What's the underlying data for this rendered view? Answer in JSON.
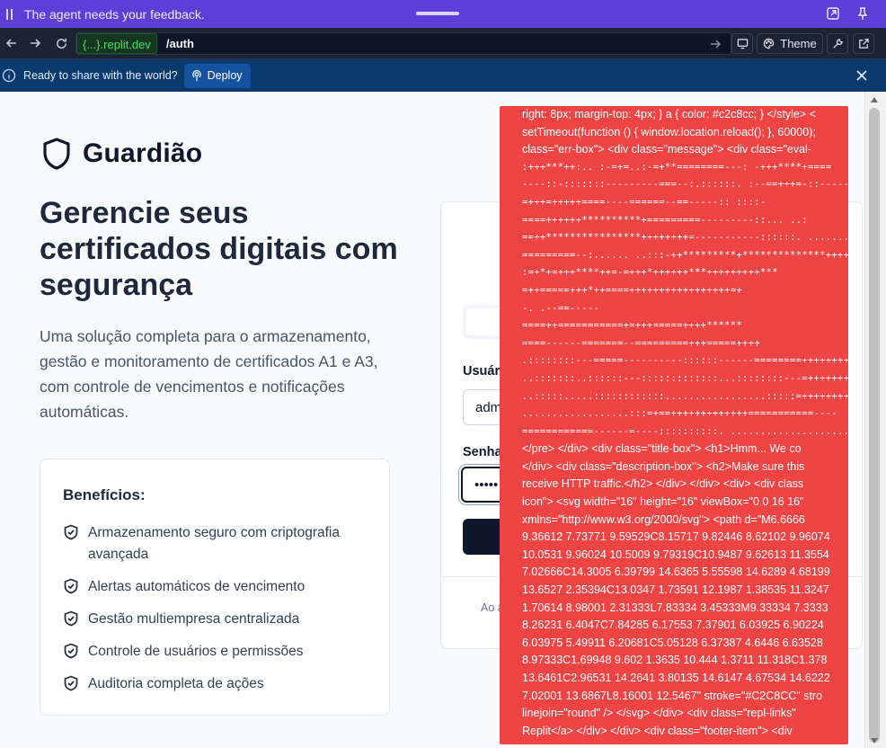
{
  "feedback": {
    "message": "The agent needs your feedback."
  },
  "browser": {
    "domain": "{...}.replit.dev",
    "path": "/auth",
    "theme_label": "Theme"
  },
  "deploy": {
    "ready_text": "Ready to share with the world?",
    "button_label": "Deploy"
  },
  "page": {
    "brand": "Guardião",
    "hero_title": "Gerencie seus certificados digitais com segurança",
    "hero_description": "Uma solução completa para o armazenamento, gestão e monitoramento de certificados A1 e A3, com controle de vencimentos e notificações automáticas.",
    "benefits_title": "Benefícios:",
    "benefits": [
      "Armazenamento seguro com criptografia avançada",
      "Alertas automáticos de vencimento",
      "Gestão multiempresa centralizada",
      "Controle de usuários e permissões",
      "Auditoria completa de ações"
    ]
  },
  "login": {
    "username_label": "Usuári",
    "username_value": "adm",
    "password_label": "Senha",
    "password_value": "•••••",
    "footer_text": "Ao a"
  },
  "error_overlay": {
    "lines": [
      "right: 8px; margin-top: 4px; } a { color: #c2c8cc; } </style> <",
      "setTimeout(function () { window.location.reload(); }, 60000);",
      "class=\"err-box\"> <div class=\"message\"> <div class=\"eval-",
      ":+++***++:.. :-=+=..:-=+**========---: -+++****+====",
      "----::-:::::::---------===--:.::::::. :--==+++=-::--------=======",
      "=+++=+++++====----======--==-----:: ::::-",
      "====++++++**********+=========---------::... ..:",
      "==++****************++++++++=-----------::::::. .......::::-=",
      "=========--:...... ..:::-++*********+**************++++++",
      ":=+*+=+++****++=-=+++*++++++***+++++++++***",
      "=++=====+++*++====+++++++++++++++++=+",
      "-. .--==-----",
      "====++===========+=+++=====++++******",
      "====------=======--=========+++=====++++",
      ".::::::::---=====----------::::::------========++++++++",
      "..:::::::..::::::---:::::::::::::...::::::::---=++++++++++****+++++++",
      "..:::::.....::::::::::::.................:::::=++++++++++*****++++++=====",
      "..................:::=+==+++++++++++++===========----",
      "============------=----::::::::::. ........................::::::::--",
      "</pre> </div> <div class=\"title-box\"> <h1>Hmm... We co",
      "</div> <div class=\"description-box\"> <h2>Make sure this",
      "receive HTTP traffic.</h2> </div> </div> <div> <div class",
      "icon\"> <svg width=\"16\" height=\"16\" viewBox=\"0 0 16 16\"",
      "xmlns=\"http://www.w3.org/2000/svg\"> <path d=\"M6.6666",
      "9.36612 7.73771 9.59529C8.15717 9.82446 8.62102 9.96074",
      "10.0531 9.96024 10.5009 9.79319C10.9487 9.62613 11.3554",
      "7.02666C14.3005 6.39799 14.6365 5.55598 14.6289 4.68199",
      "13.6527 2.35394C13.0347 1.73591 12.1987 1.38535 11.3247",
      "1.70614 8.98001 2.31333L7.83334 3.45333M9.33334 7.3333",
      "8.26231 6.4047C7.84285 6.17553 7.37901 6.03925 6.90224",
      "6.03975 5.49911 6.20681C5.05128 6.37387 4.6446 6.63528",
      "8.97333C1.69948 9.602 1.3635 10.444 1.3711 11.318C1.378",
      "13.6461C2.96531 14.2641 3.80135 14.6147 4.67534 14.6222",
      "7.02001 13.6867L8.16001 12.5467\" stroke=\"#C2C8CC\" stro",
      "linejoin=\"round\" /> </svg> </div> <div class=\"repl-links\"",
      "Replit</a> </div> </div> <div class=\"footer-item\"> <div"
    ]
  }
}
